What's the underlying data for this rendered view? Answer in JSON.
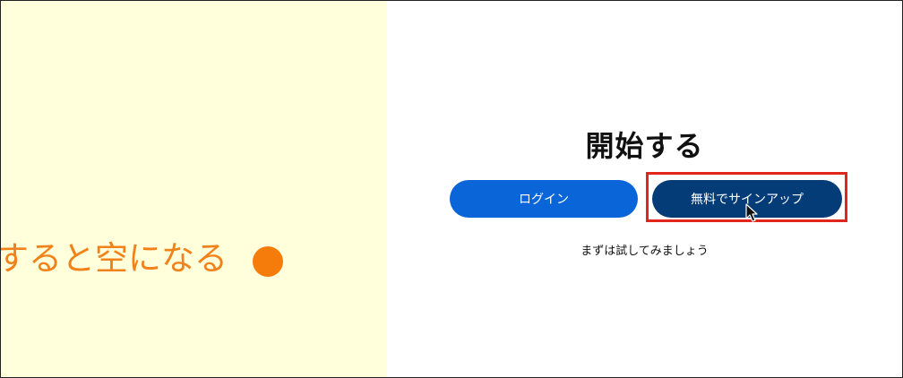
{
  "left_panel": {
    "caption": "すると空になる",
    "dot_color": "#f57c0a",
    "background": "#ffffdc",
    "text_color": "#f08219"
  },
  "main": {
    "title": "開始する",
    "login_label": "ログイン",
    "signup_label": "無料でサインアップ",
    "tagline": "まずは試してみましょう"
  },
  "colors": {
    "login_button": "#0a66d8",
    "signup_button": "#043c78",
    "highlight": "#e3261c"
  },
  "icons": {
    "cursor": "mouse-pointer-icon",
    "dot": "filled-circle-icon"
  }
}
